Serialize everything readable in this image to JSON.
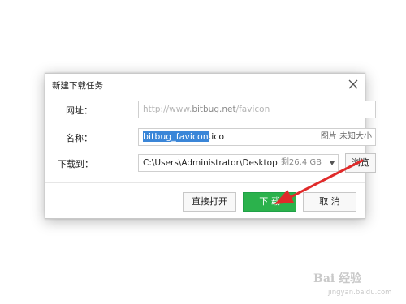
{
  "dialog": {
    "title": "新建下载任务",
    "url_label": "网址：",
    "url_value_prefix": "http://www.",
    "url_value_domain": "bitbug.net",
    "url_value_suffix": "/favicon",
    "name_label": "名称：",
    "name_selected": "bitbug_favicon",
    "name_rest": ".ico",
    "name_meta": "图片 未知大小",
    "download_label": "下载到：",
    "download_path": "C:\\Users\\Administrator\\Desktop",
    "free_space": "剩26.4 GB",
    "browse_label": "浏览",
    "open_label": "直接打开",
    "download_btn_label": "下 载",
    "cancel_label": "取 消"
  },
  "watermark": {
    "logo_text": "Bai 经验",
    "site_text": "jingyan.baidu.com"
  },
  "colors": {
    "accent_green": "#2bb24c",
    "selection_blue": "#3a86d8",
    "annotation_red": "#e02a2a"
  }
}
